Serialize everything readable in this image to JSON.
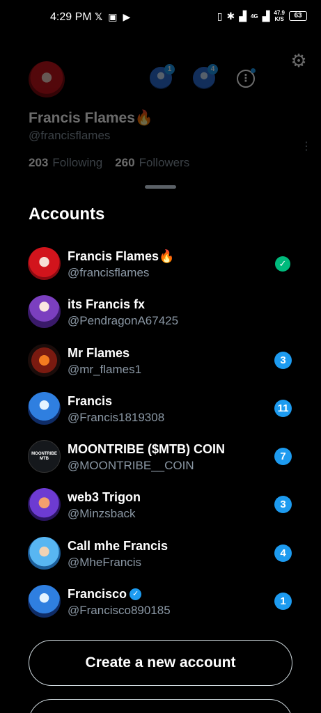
{
  "status_bar": {
    "time": "4:29 PM",
    "network_speed": "47.9",
    "network_unit": "K/S",
    "battery": "63",
    "signal_label": "4G"
  },
  "profile": {
    "name": "Francis Flames🔥",
    "handle": "@francisflames",
    "following_count": "203",
    "following_label": "Following",
    "followers_count": "260",
    "followers_label": "Followers",
    "mini_accounts": [
      {
        "badge": "1"
      },
      {
        "badge": "4"
      }
    ]
  },
  "sheet": {
    "title": "Accounts",
    "accounts": [
      {
        "name": "Francis Flames🔥",
        "handle": "@francisflames",
        "status": "active"
      },
      {
        "name": "its Francis fx",
        "handle": "@PendragonA67425",
        "badge": ""
      },
      {
        "name": "Mr Flames",
        "handle": "@mr_flames1",
        "badge": "3"
      },
      {
        "name": "Francis",
        "handle": "@Francis1819308",
        "badge": "11"
      },
      {
        "name": "MOONTRIBE ($MTB) COIN",
        "handle": "@MOONTRIBE__COIN",
        "badge": "7",
        "avatar_text": "MOONTRIBE MTB"
      },
      {
        "name": "web3 Trigon",
        "handle": "@Minzsback",
        "badge": "3"
      },
      {
        "name": "Call mhe Francis",
        "handle": "@MheFrancis",
        "badge": "4"
      },
      {
        "name": "Francisco",
        "handle": "@Francisco890185",
        "badge": "1",
        "verified": true
      }
    ],
    "create_button": "Create a new account",
    "accent_color": "#1d9bf0",
    "active_color": "#00ba7c"
  }
}
